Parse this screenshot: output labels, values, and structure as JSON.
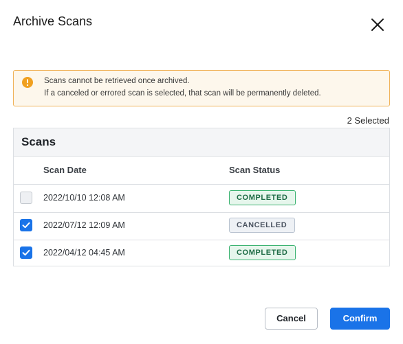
{
  "dialog": {
    "title": "Archive Scans",
    "close_icon": "close-icon"
  },
  "alert": {
    "icon": "warning-icon",
    "color": "#f0a020",
    "line1": "Scans cannot be retrieved once archived.",
    "line2": "If a canceled or errored scan is selected, that scan will be permanently deleted."
  },
  "selection": {
    "count_label": "2 Selected"
  },
  "table": {
    "title": "Scans",
    "columns": [
      "Scan Date",
      "Scan Status"
    ],
    "rows": [
      {
        "date": "2022/10/10 12:08 AM",
        "status": "COMPLETED",
        "checked": false
      },
      {
        "date": "2022/07/12 12:09 AM",
        "status": "CANCELLED",
        "checked": true
      },
      {
        "date": "2022/04/12 04:45 AM",
        "status": "COMPLETED",
        "checked": true
      }
    ]
  },
  "footer": {
    "cancel_label": "Cancel",
    "confirm_label": "Confirm",
    "accent_color": "#1a73e8"
  }
}
